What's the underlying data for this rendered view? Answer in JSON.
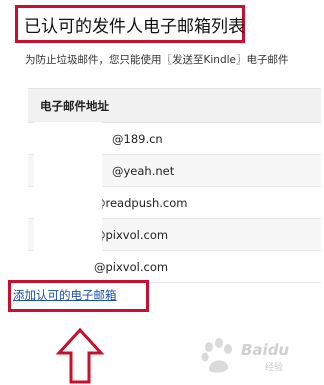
{
  "page": {
    "title": "已认可的发件人电子邮箱列表",
    "description": "为防止垃圾邮件，您只能使用〖发送至Kindle〗电子邮件"
  },
  "table": {
    "header": "电子邮件地址",
    "rows": [
      {
        "email": "@189.cn"
      },
      {
        "email": "@yeah.net"
      },
      {
        "email": "@readpush.com"
      },
      {
        "email": "@pixvol.com"
      },
      {
        "email": "@pixvol.com"
      }
    ]
  },
  "actions": {
    "add_link": "添加认可的电子邮箱"
  },
  "watermark": {
    "brand": "Baidu",
    "sub": "经验"
  },
  "colors": {
    "highlight_border": "#c8102e",
    "link": "#1a4fb5",
    "header_bg": "#f1f1f1"
  }
}
